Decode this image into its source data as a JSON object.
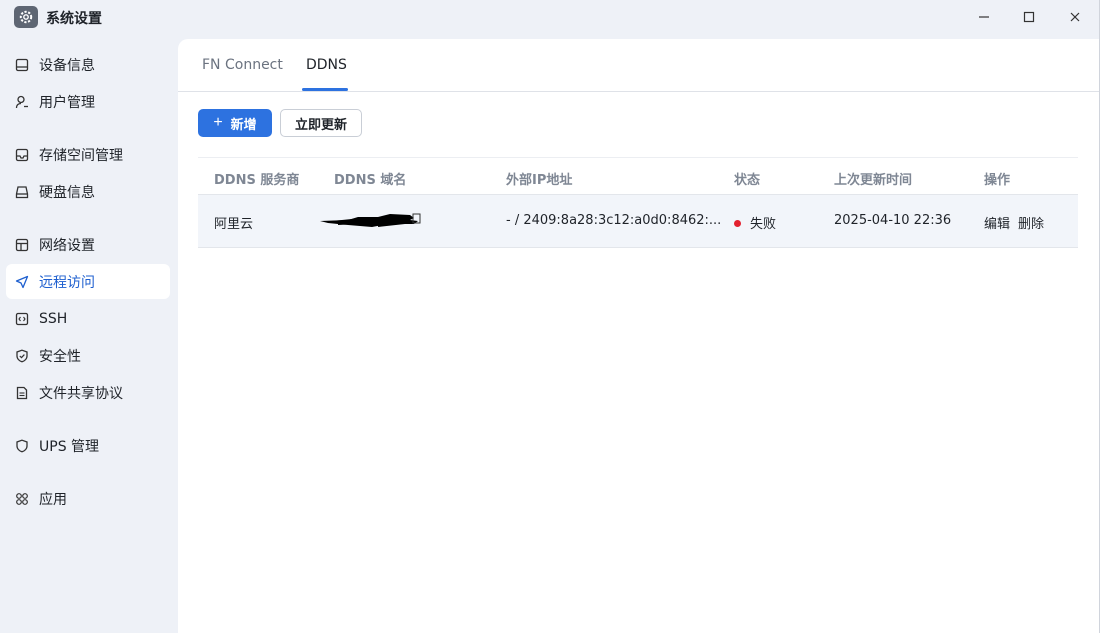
{
  "window": {
    "title": "系统设置"
  },
  "sidebar": {
    "items": [
      {
        "label": "设备信息",
        "icon": "device-icon"
      },
      {
        "label": "用户管理",
        "icon": "user-icon"
      },
      {
        "label": "存储空间管理",
        "icon": "storage-icon"
      },
      {
        "label": "硬盘信息",
        "icon": "disk-icon"
      },
      {
        "label": "网络设置",
        "icon": "network-icon"
      },
      {
        "label": "远程访问",
        "icon": "send-icon",
        "active": true
      },
      {
        "label": "SSH",
        "icon": "code-icon"
      },
      {
        "label": "安全性",
        "icon": "shield-check-icon"
      },
      {
        "label": "文件共享协议",
        "icon": "file-icon"
      },
      {
        "label": "UPS 管理",
        "icon": "shield-icon"
      },
      {
        "label": "应用",
        "icon": "apps-icon"
      }
    ]
  },
  "tabs": [
    {
      "label": "FN Connect"
    },
    {
      "label": "DDNS",
      "active": true
    }
  ],
  "toolbar": {
    "add_label": "新增",
    "refresh_label": "立即更新"
  },
  "table": {
    "headers": [
      "DDNS 服务商",
      "DDNS 域名",
      "外部IP地址",
      "状态",
      "上次更新时间",
      "操作"
    ],
    "rows": [
      {
        "provider": "阿里云",
        "domain": "",
        "ip": "- / 2409:8a28:3c12:a0d0:8462:...",
        "status": "失败",
        "updated": "2025-04-10 22:36",
        "actions": [
          "编辑",
          "删除"
        ]
      }
    ]
  },
  "colors": {
    "accent": "#2d72e0",
    "status_fail": "#e3212f",
    "sidebar_bg": "#eef1f7"
  }
}
